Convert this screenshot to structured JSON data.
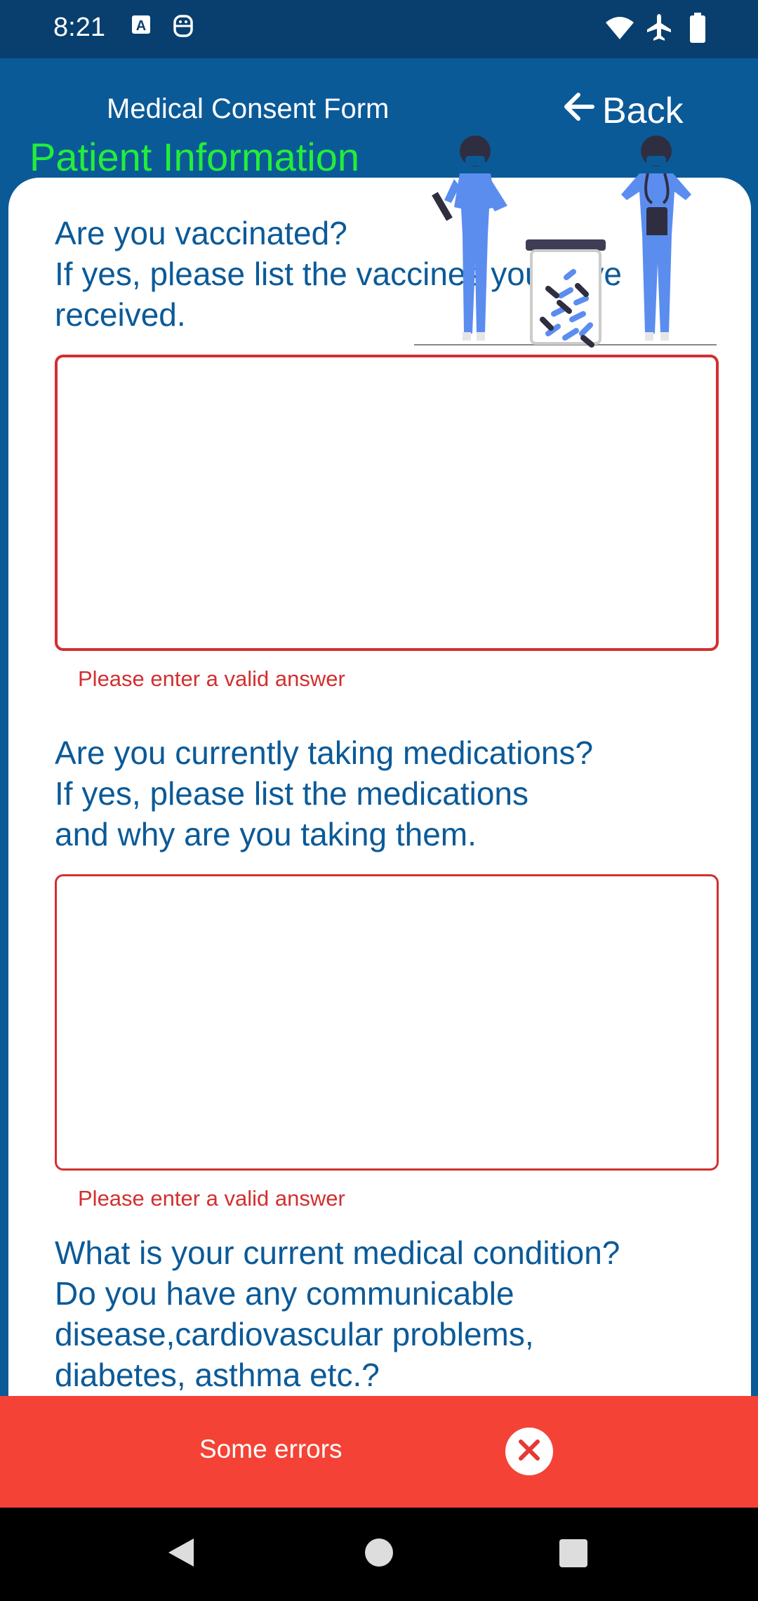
{
  "status_bar": {
    "time": "8:21",
    "icons": [
      "font-a-icon",
      "smiley-face-icon",
      "wifi-icon",
      "airplane-icon",
      "battery-icon"
    ]
  },
  "header": {
    "title": "Medical Consent Form",
    "back_label": "Back",
    "section_title": "Patient Information"
  },
  "form": {
    "questions": [
      {
        "text": "Are you vaccinated?\nIf yes, please list the vaccines you have\nreceived.",
        "value": "",
        "error": "Please enter a valid answer"
      },
      {
        "text": "Are you currently taking medications?\nIf yes, please list the medications\nand why are you taking them.",
        "value": "",
        "error": "Please enter a valid answer"
      },
      {
        "text": "What is your current medical condition?\nDo you have any communicable\ndisease,cardiovascular problems,\ndiabetes, asthma etc.?"
      }
    ]
  },
  "error_banner": {
    "label": "Some errors"
  },
  "colors": {
    "primary": "#0b5a98",
    "status_bar": "#083f6e",
    "section_title": "#22ee3a",
    "error": "#d32f2f",
    "banner": "#f44336"
  }
}
